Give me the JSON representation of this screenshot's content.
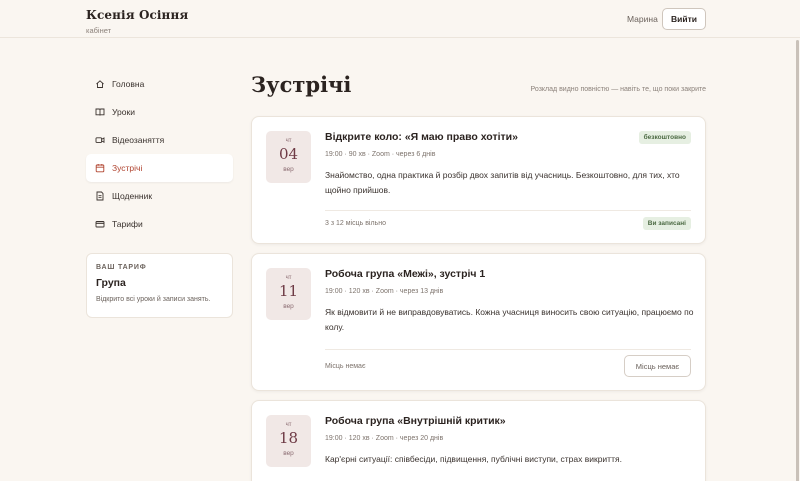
{
  "brand": {
    "name": "Ксенія Осіння",
    "subtitle": "кабінет"
  },
  "header": {
    "user_name": "Марина",
    "logout_label": "Вийти"
  },
  "sidebar": {
    "items": [
      {
        "label": "Головна",
        "icon": "home-icon",
        "active": false
      },
      {
        "label": "Уроки",
        "icon": "book-icon",
        "active": false
      },
      {
        "label": "Відеозаняття",
        "icon": "video-icon",
        "active": false
      },
      {
        "label": "Зустрічі",
        "icon": "calendar-icon",
        "active": true
      },
      {
        "label": "Щоденник",
        "icon": "journal-icon",
        "active": false
      },
      {
        "label": "Тарифи",
        "icon": "card-icon",
        "active": false
      }
    ],
    "tariff": {
      "caption": "ВАШ ТАРИФ",
      "name": "Група",
      "description": "Відкрито всі уроки й записи занять."
    }
  },
  "main": {
    "title": "Зустрічі",
    "note": "Розклад видно повністю — навіть те, що поки закрите",
    "meetings": [
      {
        "dow": "чт",
        "day": "04",
        "month": "вер",
        "title": "Відкрите коло: «Я маю право хотіти»",
        "meta": "19:00 · 90 хв · Zoom · через 6 днів",
        "description": "Знайомство, одна практика й розбір двох запитів від учасниць. Безкоштовно, для тих, хто щойно прийшов.",
        "badge": "безкоштовно",
        "footer_text": "3 з 12 місць вільно",
        "status_label": "Ви записані"
      },
      {
        "dow": "чт",
        "day": "11",
        "month": "вер",
        "title": "Робоча група «Межі», зустріч 1",
        "meta": "19:00 · 120 хв · Zoom · через 13 днів",
        "description": "Як відмовити й не виправдовуватись. Кожна учасниця виносить свою ситуацію, працюємо по колу.",
        "footer_text": "Місць немає",
        "button_label": "Місць немає"
      },
      {
        "dow": "чт",
        "day": "18",
        "month": "вер",
        "title": "Робоча група «Внутрішній критик»",
        "meta": "19:00 · 120 хв · Zoom · через 20 днів",
        "description": "Кар'єрні ситуації: співбесіди, підвищення, публічні виступи, страх викриття."
      }
    ]
  },
  "colors": {
    "accent": "#b0432f",
    "background": "#faf6f1",
    "date_bg": "#f1e8e6",
    "badge_green": "#e6efe2"
  }
}
